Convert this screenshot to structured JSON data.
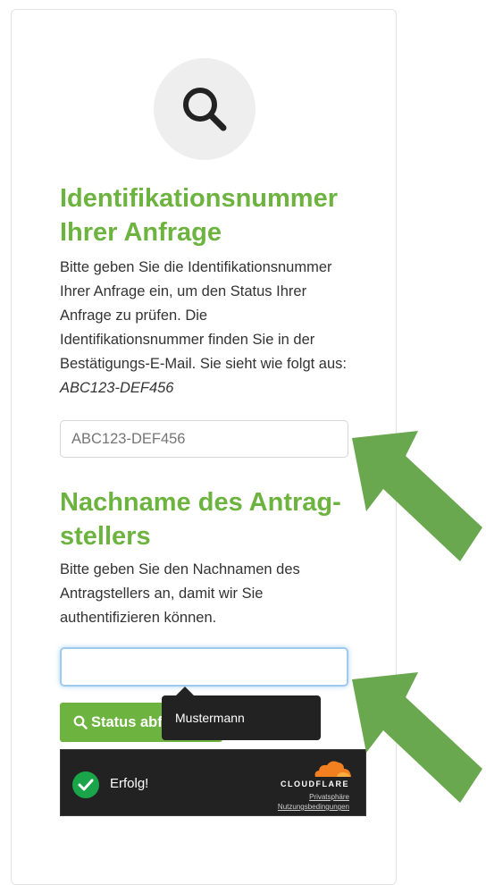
{
  "colors": {
    "accent": "#6db33f",
    "tooltip_bg": "#222222",
    "cloudflare_orange": "#f38020",
    "success_green": "#1aa54a"
  },
  "search_icon": "magnifier-icon",
  "section1": {
    "heading": "Identifikationsnummer Ihrer Anfrage",
    "description": "Bitte geben Sie die Identifikationsnummer Ihrer Anfrage ein, um den Status Ihrer Anfrage zu prüfen. Die Identifikationsnummer finden Sie in der Bestätigungs-E-Mail. Sie sieht wie folgt aus: ",
    "example": "ABC123-DEF456",
    "input_placeholder": "ABC123-DEF456",
    "input_value": ""
  },
  "section2": {
    "heading": "Nachname des Antrag-stellers",
    "description": "Bitte geben Sie den Nachnamen des Antragstellers an, damit wir Sie authentifizieren können.",
    "input_value": "",
    "tooltip": "Mustermann"
  },
  "submit_button": {
    "icon": "search-icon",
    "label": "Status abfragen"
  },
  "cloudflare": {
    "status": "Erfolg!",
    "brand": "CLOUDFLARE",
    "privacy_link": "Privatsphäre",
    "terms_link": "Nutzungsbedingungen"
  },
  "annotations": {
    "arrow_icon": "green-arrow-icon",
    "arrow_color": "#6aa84f"
  }
}
